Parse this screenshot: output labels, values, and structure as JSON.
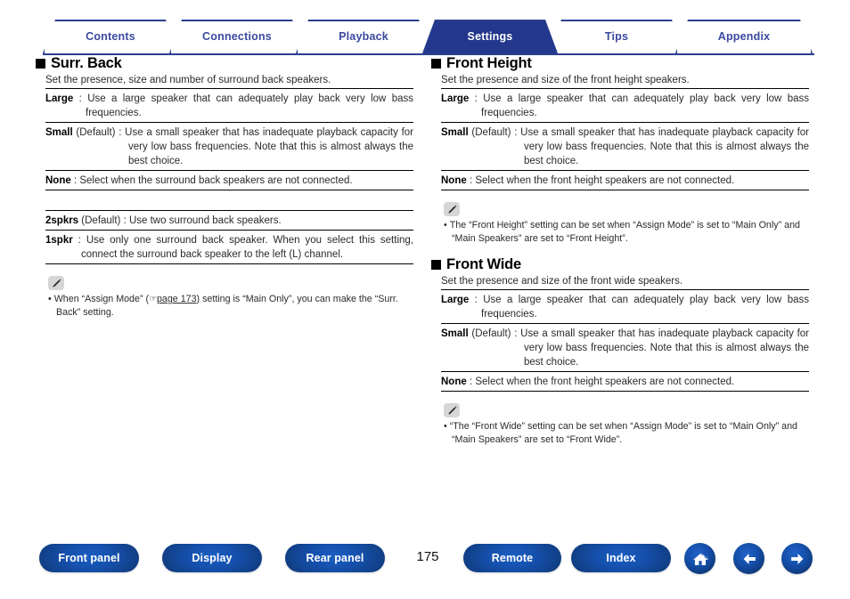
{
  "tabs": [
    {
      "label": "Contents",
      "active": false
    },
    {
      "label": "Connections",
      "active": false
    },
    {
      "label": "Playback",
      "active": false
    },
    {
      "label": "Settings",
      "active": true
    },
    {
      "label": "Tips",
      "active": false
    },
    {
      "label": "Appendix",
      "active": false
    }
  ],
  "left_column": {
    "section1": {
      "title": "Surr. Back",
      "description": "Set the presence, size and number of surround back speakers.",
      "rows": [
        {
          "term": "Large",
          "text": " : Use a large speaker that can adequately play back very low bass frequencies."
        },
        {
          "term": "Small",
          "text": " (Default) : Use a small speaker that has inadequate playback capacity for very low bass frequencies. Note that this is almost always the best choice."
        },
        {
          "term": "None",
          "text": " : Select when the surround back speakers are not connected."
        }
      ],
      "rows2": [
        {
          "term": "2spkrs",
          "text": " (Default) : Use two surround back speakers."
        },
        {
          "term": "1spkr",
          "text": " : Use only one surround back speaker. When you select this setting, connect the surround back speaker to the left (L) channel."
        }
      ],
      "note": {
        "before_link": "When “Assign Mode” (",
        "link": "page 173",
        "after_link": ") setting is “Main Only”, you can make the “Surr. Back” setting."
      }
    }
  },
  "right_column": {
    "section1": {
      "title": "Front Height",
      "description": "Set the presence and size of the front height speakers.",
      "rows": [
        {
          "term": "Large",
          "text": " : Use a large speaker that can adequately play back very low bass frequencies."
        },
        {
          "term": "Small",
          "text": " (Default) : Use a small speaker that has inadequate playback capacity for very low bass frequencies. Note that this is almost always the best choice."
        },
        {
          "term": "None",
          "text": " : Select when the front height speakers are not connected."
        }
      ],
      "note": "The “Front Height” setting can be set when “Assign Mode” is set to “Main Only” and “Main Speakers” are set to “Front Height”."
    },
    "section2": {
      "title": "Front Wide",
      "description": "Set the presence and size of the front wide speakers.",
      "rows": [
        {
          "term": "Large",
          "text": " : Use a large speaker that can adequately play back very low bass frequencies."
        },
        {
          "term": "Small",
          "text": " (Default) : Use a small speaker that has inadequate playback capacity for very low bass frequencies. Note that this is almost always the best choice."
        },
        {
          "term": "None",
          "text": " : Select when the front height speakers are not connected."
        }
      ],
      "note": "“The “Front Wide” setting can be set when “Assign Mode” is set to “Main Only” and “Main Speakers” are set to “Front Wide”."
    }
  },
  "footer": {
    "buttons": [
      {
        "label": "Front panel"
      },
      {
        "label": "Display"
      },
      {
        "label": "Rear panel"
      },
      {
        "label": "Remote"
      },
      {
        "label": "Index"
      }
    ],
    "page_number": "175",
    "icons": [
      "home-icon",
      "arrow-left-icon",
      "arrow-right-icon"
    ]
  },
  "colors": {
    "tab_border": "#2b3f8f",
    "tab_text": "#3b4a9e",
    "tab_active_bg": "#23388c",
    "button_blue": "#1550ac"
  }
}
